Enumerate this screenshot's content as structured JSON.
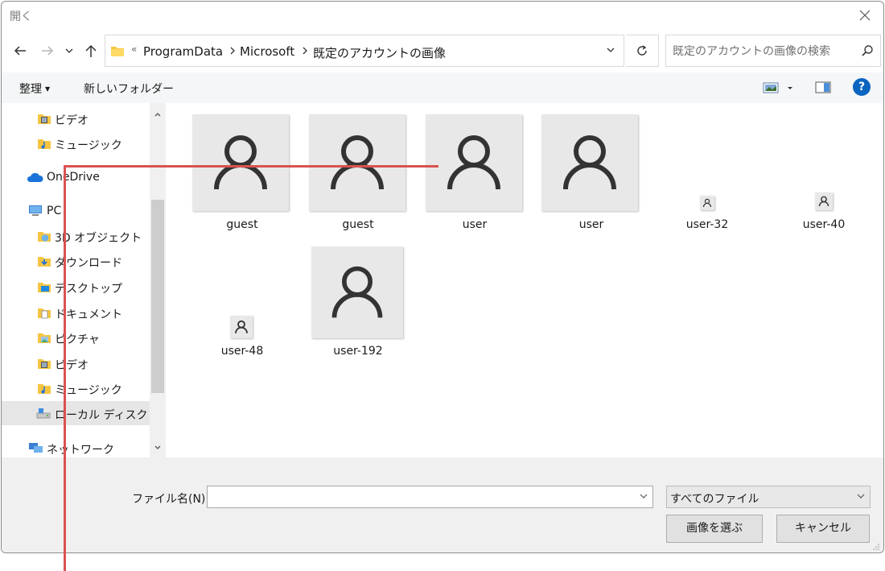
{
  "window": {
    "title": "開く"
  },
  "address": {
    "overflow": "«",
    "crumbs": [
      "ProgramData",
      "Microsoft",
      "既定のアカウントの画像"
    ]
  },
  "search": {
    "placeholder": "既定のアカウントの画像の検索"
  },
  "toolbar": {
    "organize": "整理",
    "new_folder": "新しいフォルダー",
    "help": "?"
  },
  "nav": {
    "items": [
      {
        "label": "ビデオ",
        "icon": "video-folder-icon"
      },
      {
        "label": "ミュージック",
        "icon": "music-folder-icon"
      },
      {
        "label": "OneDrive",
        "icon": "onedrive-cloud-icon"
      },
      {
        "label": "PC",
        "icon": "pc-icon"
      },
      {
        "label": "3D オブジェクト",
        "icon": "3d-objects-folder-icon"
      },
      {
        "label": "ダウンロード",
        "icon": "downloads-folder-icon"
      },
      {
        "label": "デスクトップ",
        "icon": "desktop-folder-icon"
      },
      {
        "label": "ドキュメント",
        "icon": "documents-folder-icon"
      },
      {
        "label": "ピクチャ",
        "icon": "pictures-folder-icon"
      },
      {
        "label": "ビデオ",
        "icon": "video-folder-icon"
      },
      {
        "label": "ミュージック",
        "icon": "music-folder-icon"
      },
      {
        "label": "ローカル ディスク (C:",
        "icon": "local-disk-icon"
      },
      {
        "label": "ネットワーク",
        "icon": "network-icon"
      }
    ]
  },
  "files": [
    {
      "name": "guest"
    },
    {
      "name": "guest"
    },
    {
      "name": "user"
    },
    {
      "name": "user"
    },
    {
      "name": "user-32"
    },
    {
      "name": "user-40"
    },
    {
      "name": "user-48"
    },
    {
      "name": "user-192"
    }
  ],
  "bottom": {
    "filename_label": "ファイル名(N):",
    "filename_value": "",
    "filetype": "すべてのファイル",
    "ok": "画像を選ぶ",
    "cancel": "キャンセル"
  },
  "colors": {
    "annotation": "#d9534f",
    "help": "#0a64c0",
    "thumb": "#e8e8e8"
  }
}
